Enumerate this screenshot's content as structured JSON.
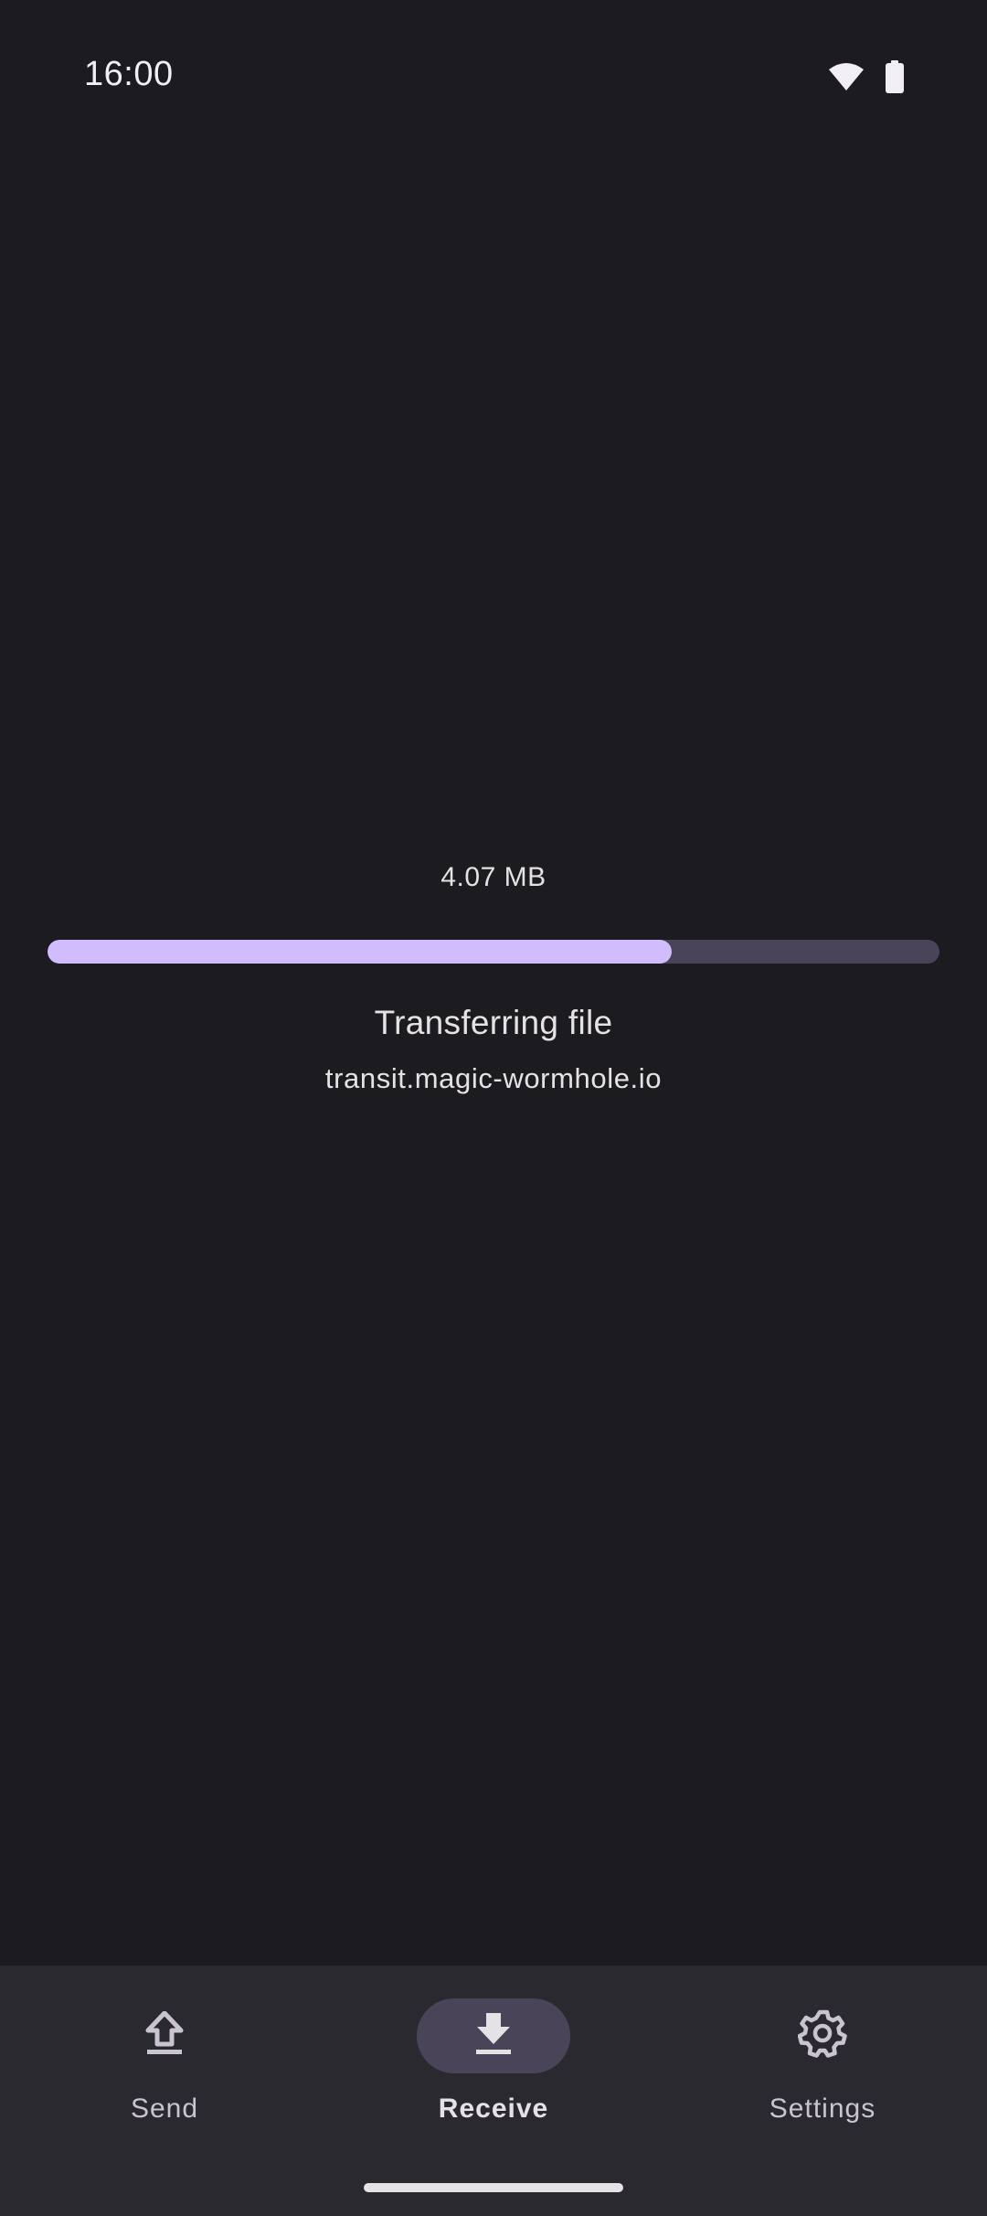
{
  "status_bar": {
    "time": "16:00",
    "icons": [
      "wifi-icon",
      "battery-icon"
    ]
  },
  "transfer": {
    "size": "4.07 MB",
    "progress_percent": 70,
    "title": "Transferring file",
    "host": "transit.magic-wormhole.io"
  },
  "nav": {
    "items": [
      {
        "label": "Send",
        "icon": "upload-icon",
        "active": false
      },
      {
        "label": "Receive",
        "icon": "download-icon",
        "active": true
      },
      {
        "label": "Settings",
        "icon": "gear-icon",
        "active": false
      }
    ]
  },
  "colors": {
    "background": "#1c1b1f",
    "accent": "#d0bcff",
    "track": "#4a4458",
    "nav_background": "#2b2930"
  }
}
